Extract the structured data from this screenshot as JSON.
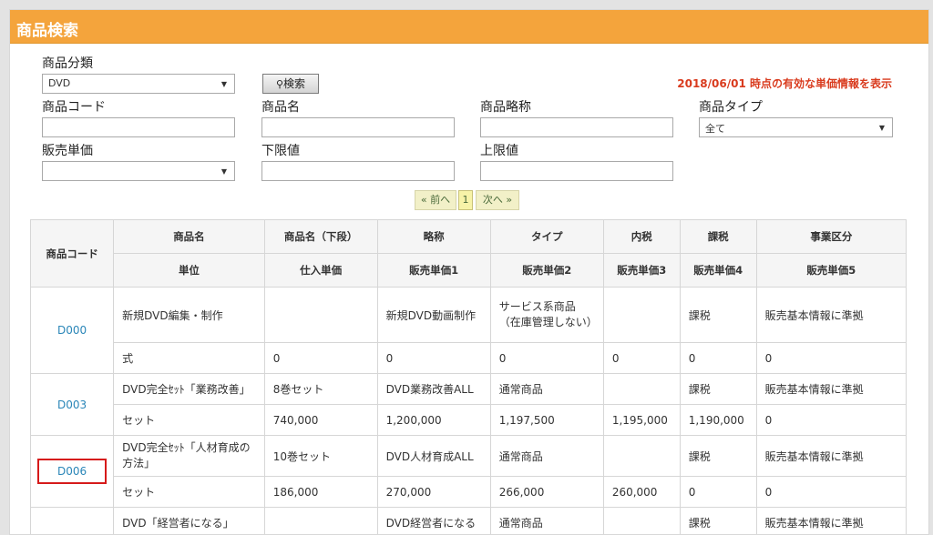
{
  "page": {
    "title": "商品検索"
  },
  "search": {
    "category_label": "商品分類",
    "category_value": "DVD",
    "search_button": "検索",
    "notice": "2018/06/01 時点の有効な単価情報を表示",
    "code_label": "商品コード",
    "name_label": "商品名",
    "abbr_label": "商品略称",
    "type_label": "商品タイプ",
    "type_value": "全て",
    "price_label": "販売単価",
    "price_value": "",
    "lower_label": "下限値",
    "upper_label": "上限値"
  },
  "pager": {
    "prev": "« 前へ",
    "page": "1",
    "next": "次へ »"
  },
  "table": {
    "header1": [
      "商品コード",
      "商品名",
      "商品名（下段）",
      "略称",
      "タイプ",
      "内税",
      "課税",
      "事業区分"
    ],
    "header2": [
      "単位",
      "仕入単価",
      "販売単価1",
      "販売単価2",
      "販売単価3",
      "販売単価4",
      "販売単価5"
    ],
    "rows": [
      {
        "code": "D000",
        "top": [
          "新規DVD編集・制作",
          "",
          "新規DVD動画制作",
          "サービス系商品（在庫管理しない）",
          "",
          "課税",
          "販売基本情報に準拠"
        ],
        "bottom": [
          "式",
          "0",
          "0",
          "0",
          "0",
          "0",
          "0"
        ]
      },
      {
        "code": "D003",
        "top": [
          "DVD完全ｾｯﾄ「業務改善」",
          "8巻セット",
          "DVD業務改善ALL",
          "通常商品",
          "",
          "課税",
          "販売基本情報に準拠"
        ],
        "bottom": [
          "セット",
          "740,000",
          "1,200,000",
          "1,197,500",
          "1,195,000",
          "1,190,000",
          "0"
        ]
      },
      {
        "code": "D006",
        "top": [
          "DVD完全ｾｯﾄ「人材育成の方法」",
          "10巻セット",
          "DVD人材育成ALL",
          "通常商品",
          "",
          "課税",
          "販売基本情報に準拠"
        ],
        "bottom": [
          "セット",
          "186,000",
          "270,000",
          "266,000",
          "260,000",
          "0",
          "0"
        ]
      },
      {
        "code": "",
        "top": [
          "DVD「経営者になる」",
          "",
          "DVD経営者になる",
          "通常商品",
          "",
          "課税",
          "販売基本情報に準拠"
        ],
        "bottom": [
          "",
          "",
          "",
          "",
          "",
          "",
          ""
        ]
      }
    ]
  }
}
